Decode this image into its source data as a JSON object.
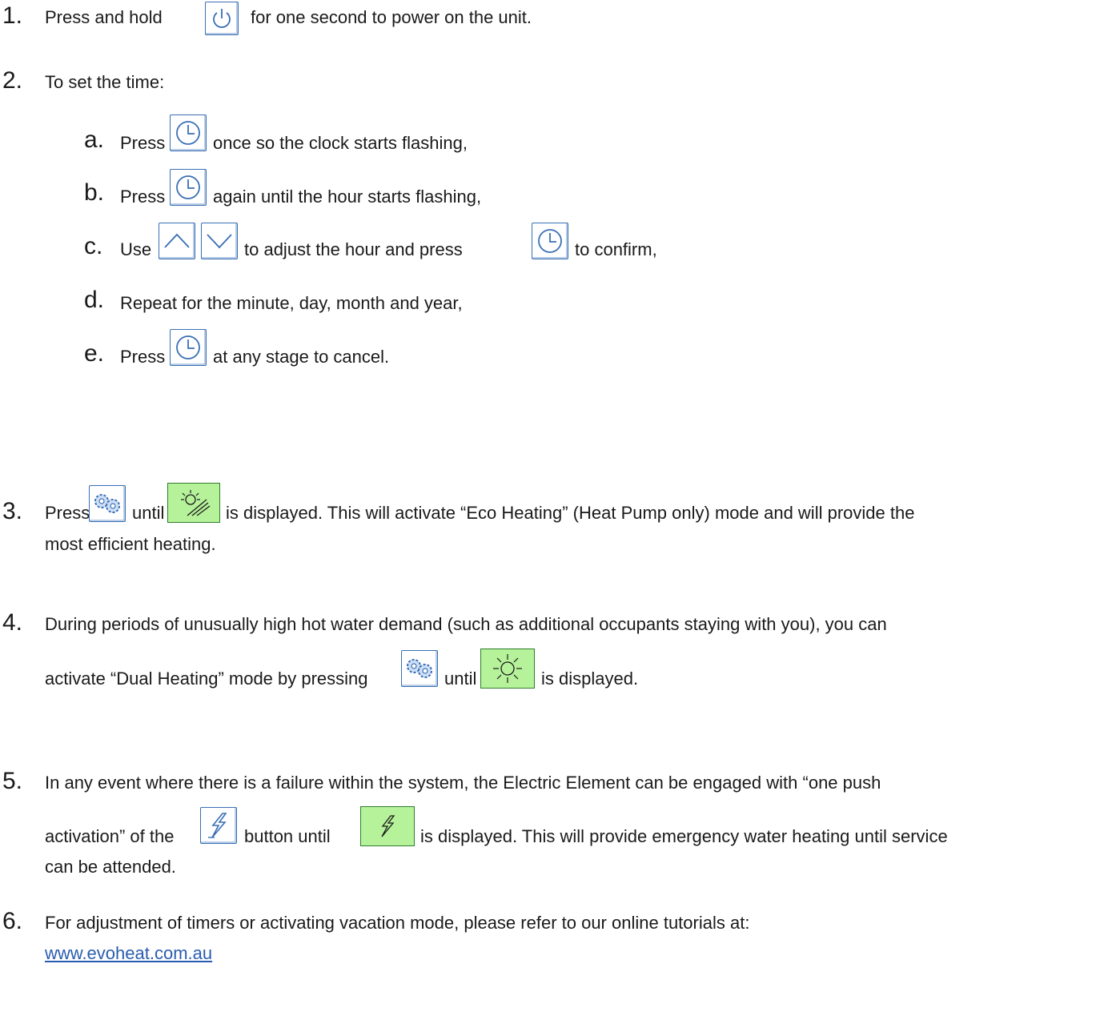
{
  "steps": [
    {
      "number": "1.",
      "parts": [
        "Press and hold",
        "for one second to power on the unit."
      ],
      "icons": [
        "power-icon"
      ]
    },
    {
      "number": "2.",
      "text": "To set the time:",
      "substeps": [
        {
          "letter": "a.",
          "parts": [
            "Press",
            "once so the clock starts flashing,"
          ],
          "icons": [
            "clock-icon"
          ]
        },
        {
          "letter": "b.",
          "parts": [
            "Press",
            "again until the hour starts flashing,"
          ],
          "icons": [
            "clock-icon"
          ]
        },
        {
          "letter": "c.",
          "parts": [
            "Use",
            "to adjust the hour and press",
            "to confirm,"
          ],
          "icons": [
            "chevron-up-icon",
            "chevron-down-icon",
            "clock-icon"
          ]
        },
        {
          "letter": "d.",
          "text": "Repeat for the minute, day, month and year,"
        },
        {
          "letter": "e.",
          "parts": [
            "Press",
            "at any stage to cancel."
          ],
          "icons": [
            "clock-icon"
          ]
        }
      ]
    },
    {
      "number": "3.",
      "parts": [
        "Press",
        "until",
        "is displayed. This will activate “Eco Heating” (Heat Pump only) mode and will provide the"
      ],
      "line2": "most efficient heating.",
      "icons": [
        "gears-icon",
        "eco-heating-icon"
      ]
    },
    {
      "number": "4.",
      "text": "During periods of unusually high hot water demand (such as additional occupants staying with you), you can",
      "parts": [
        "activate “Dual Heating” mode by pressing",
        "until",
        "is displayed."
      ],
      "icons": [
        "gears-icon",
        "dual-heating-icon"
      ]
    },
    {
      "number": "5.",
      "text": "In any event where there is a failure within the system, the Electric Element can be engaged with “one push",
      "parts": [
        "activation” of the",
        "button until",
        "is displayed. This will provide emergency water heating until service"
      ],
      "line3": "can be attended.",
      "icons": [
        "electric-element-icon",
        "electric-display-icon"
      ]
    },
    {
      "number": "6.",
      "text": "For adjustment of timers or activating vacation mode, please refer to our online tutorials at:",
      "link": "www.evoheat.com.au"
    }
  ],
  "colors": {
    "button_border": "#3a6fb5",
    "display_fill": "#b6f29a",
    "link": "#2a5db0"
  }
}
